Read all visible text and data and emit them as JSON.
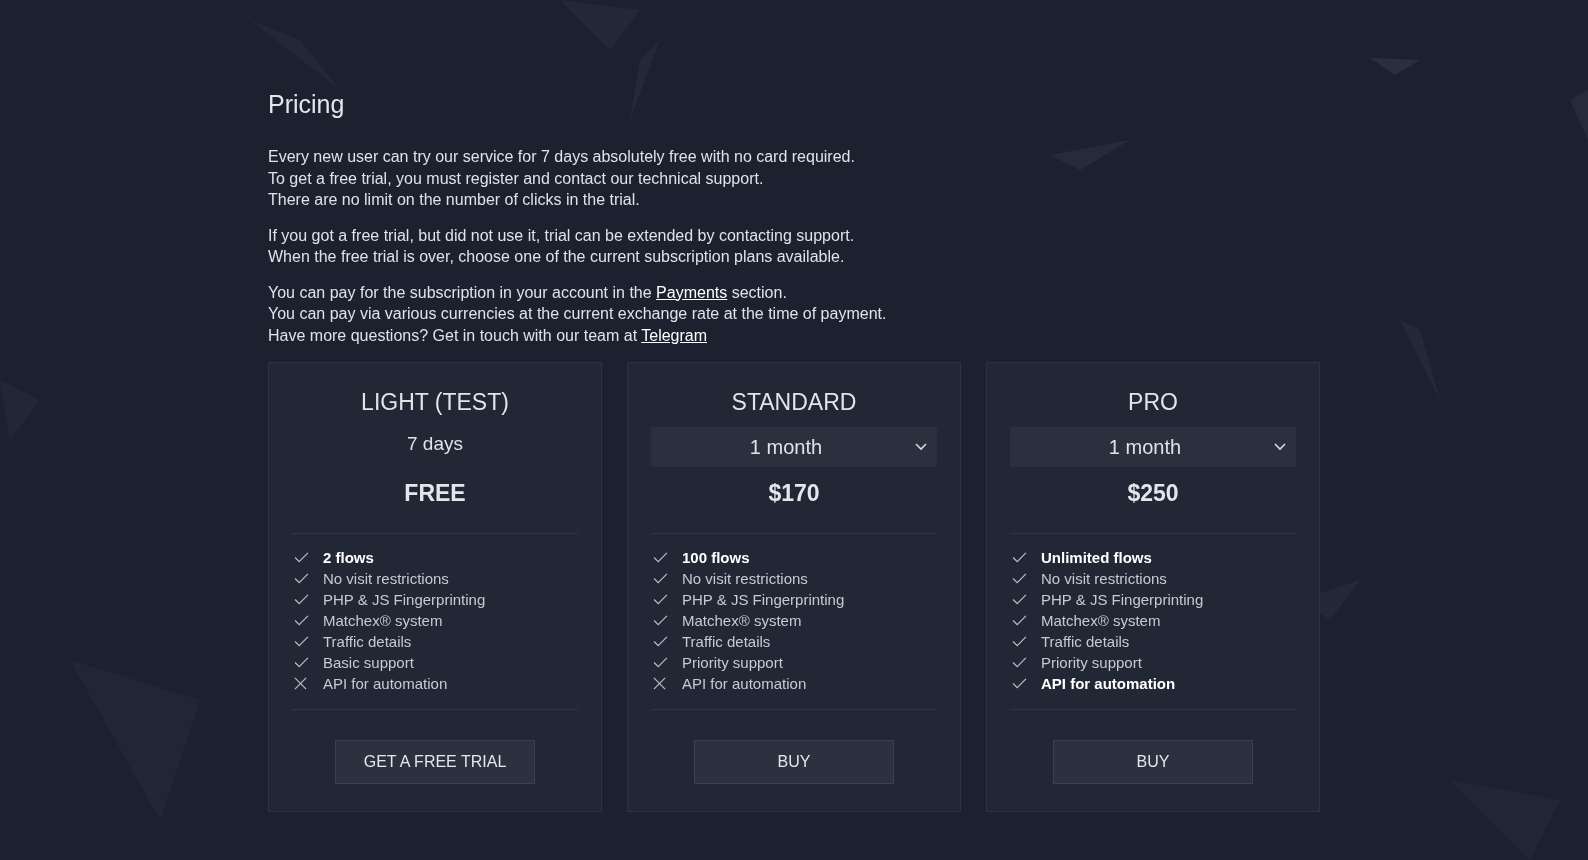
{
  "page": {
    "title": "Pricing"
  },
  "paragraphs": [
    {
      "lines": [
        {
          "parts": [
            {
              "kind": "text",
              "text": "Every new user can try our service for 7 days absolutely free with no card required."
            }
          ]
        },
        {
          "parts": [
            {
              "kind": "text",
              "text": "To get a free trial, you must register and contact our technical support."
            }
          ]
        },
        {
          "parts": [
            {
              "kind": "text",
              "text": "There are no limit on the number of clicks in the trial."
            }
          ]
        }
      ]
    },
    {
      "lines": [
        {
          "parts": [
            {
              "kind": "text",
              "text": "If you got a free trial, but did not use it, trial can be extended by contacting support."
            }
          ]
        },
        {
          "parts": [
            {
              "kind": "text",
              "text": "When the free trial is over, choose one of the current subscription plans available."
            }
          ]
        }
      ]
    },
    {
      "lines": [
        {
          "parts": [
            {
              "kind": "text",
              "text": "You can pay for the subscription in your account in the "
            },
            {
              "kind": "link",
              "text": "Payments"
            },
            {
              "kind": "text",
              "text": " section."
            }
          ]
        },
        {
          "parts": [
            {
              "kind": "text",
              "text": "You can pay via various currencies at the current exchange rate at the time of payment."
            }
          ]
        },
        {
          "parts": [
            {
              "kind": "text",
              "text": "Have more questions? Get in touch with our team at "
            },
            {
              "kind": "link",
              "text": "Telegram"
            }
          ]
        }
      ]
    }
  ],
  "plans": [
    {
      "name": "LIGHT (TEST)",
      "period": {
        "kind": "text",
        "value": "7 days"
      },
      "price": "FREE",
      "features": [
        {
          "label": "2 flows",
          "included": true,
          "highlighted": true
        },
        {
          "label": "No visit restrictions",
          "included": true,
          "highlighted": false
        },
        {
          "label": "PHP & JS Fingerprinting",
          "included": true,
          "highlighted": false
        },
        {
          "label": "Matchex® system",
          "included": true,
          "highlighted": false
        },
        {
          "label": "Traffic details",
          "included": true,
          "highlighted": false
        },
        {
          "label": "Basic support",
          "included": true,
          "highlighted": false
        },
        {
          "label": "API for automation",
          "included": false,
          "highlighted": false
        }
      ],
      "button": "GET A FREE TRIAL"
    },
    {
      "name": "STANDARD",
      "period": {
        "kind": "dropdown",
        "value": "1 month"
      },
      "price": "$170",
      "features": [
        {
          "label": "100 flows",
          "included": true,
          "highlighted": true
        },
        {
          "label": "No visit restrictions",
          "included": true,
          "highlighted": false
        },
        {
          "label": "PHP & JS Fingerprinting",
          "included": true,
          "highlighted": false
        },
        {
          "label": "Matchex® system",
          "included": true,
          "highlighted": false
        },
        {
          "label": "Traffic details",
          "included": true,
          "highlighted": false
        },
        {
          "label": "Priority support",
          "included": true,
          "highlighted": false
        },
        {
          "label": "API for automation",
          "included": false,
          "highlighted": false
        }
      ],
      "button": "BUY"
    },
    {
      "name": "PRO",
      "period": {
        "kind": "dropdown",
        "value": "1 month"
      },
      "price": "$250",
      "features": [
        {
          "label": "Unlimited flows",
          "included": true,
          "highlighted": true
        },
        {
          "label": "No visit restrictions",
          "included": true,
          "highlighted": false
        },
        {
          "label": "PHP & JS Fingerprinting",
          "included": true,
          "highlighted": false
        },
        {
          "label": "Matchex® system",
          "included": true,
          "highlighted": false
        },
        {
          "label": "Traffic details",
          "included": true,
          "highlighted": false
        },
        {
          "label": "Priority support",
          "included": true,
          "highlighted": false
        },
        {
          "label": "API for automation",
          "included": true,
          "highlighted": true
        }
      ],
      "button": "BUY"
    }
  ]
}
